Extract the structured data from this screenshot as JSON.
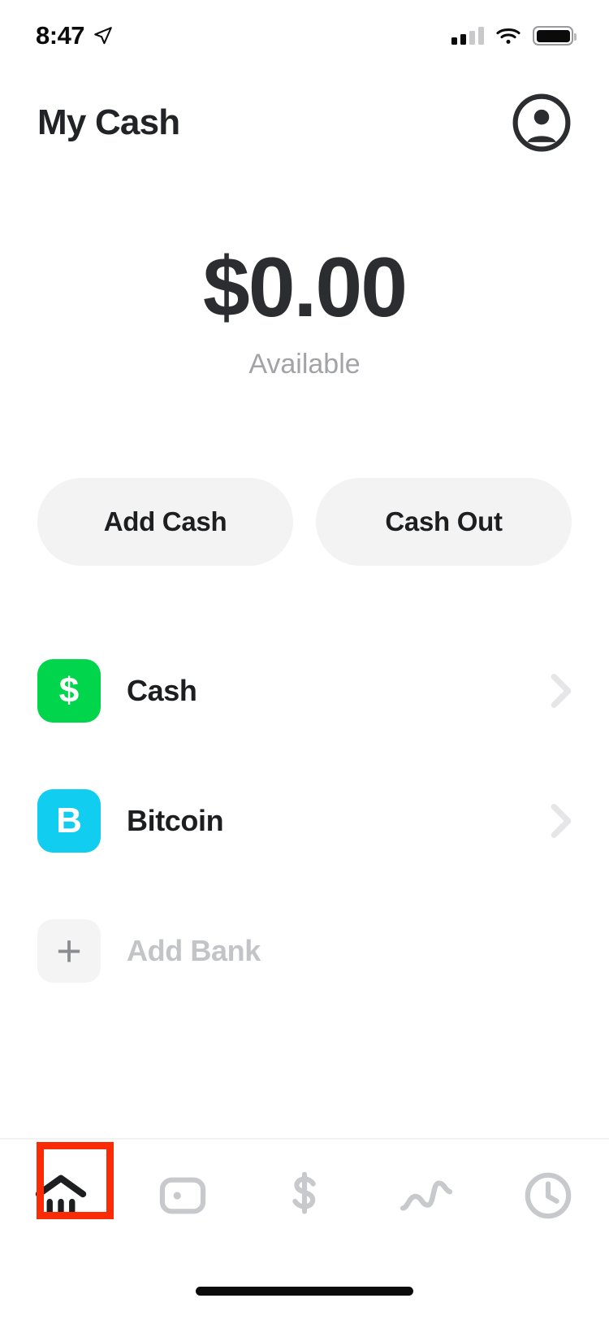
{
  "status_bar": {
    "time": "8:47",
    "location_icon": "location-arrow-icon",
    "cellular_icon": "cellular-signal-icon",
    "cellular_bars_filled": 2,
    "cellular_bars_total": 4,
    "wifi_icon": "wifi-icon",
    "battery_icon": "battery-icon",
    "battery_level_percent": 90
  },
  "header": {
    "title": "My Cash",
    "profile_icon": "profile-avatar-icon"
  },
  "balance": {
    "amount": "$0.00",
    "label": "Available"
  },
  "actions": [
    {
      "label": "Add Cash",
      "name": "add-cash-button"
    },
    {
      "label": "Cash Out",
      "name": "cash-out-button"
    }
  ],
  "accounts": [
    {
      "label": "Cash",
      "icon_glyph": "$",
      "icon_name": "cash-dollar-icon",
      "icon_color": "#00D54B",
      "has_chevron": true,
      "muted": false
    },
    {
      "label": "Bitcoin",
      "icon_glyph": "B",
      "icon_name": "bitcoin-icon",
      "icon_color": "#11CDEF",
      "has_chevron": true,
      "muted": false
    },
    {
      "label": "Add Bank",
      "icon_glyph": "+",
      "icon_name": "plus-icon",
      "icon_color": "#F4F4F5",
      "has_chevron": false,
      "muted": true
    }
  ],
  "tabs": [
    {
      "name": "tab-banking",
      "icon": "bank-icon",
      "active": true
    },
    {
      "name": "tab-card",
      "icon": "card-icon",
      "active": false
    },
    {
      "name": "tab-payments",
      "icon": "dollar-icon",
      "active": false
    },
    {
      "name": "tab-investing",
      "icon": "squiggle-icon",
      "active": false
    },
    {
      "name": "tab-activity",
      "icon": "clock-icon",
      "active": false
    }
  ],
  "annotation": {
    "highlight_color": "#FA2B06",
    "highlight_target": "tab-banking"
  },
  "colors": {
    "background": "#FFFFFF",
    "text_primary": "#1D1E20",
    "text_muted": "#A2A3A6",
    "pill_background": "#F3F3F4",
    "cash_green": "#00D54B",
    "bitcoin_cyan": "#11CDEF"
  }
}
